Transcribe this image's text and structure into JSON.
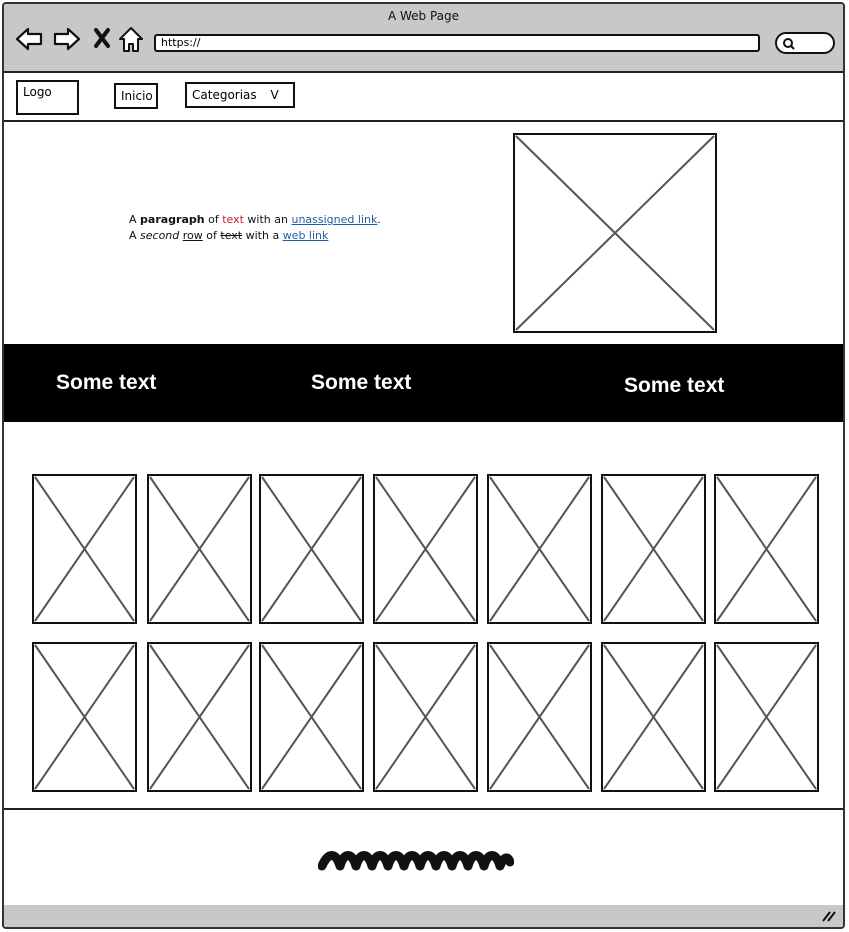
{
  "window": {
    "title": "A Web Page"
  },
  "browser": {
    "url": "https://",
    "icons": [
      "back-arrow-icon",
      "forward-arrow-icon",
      "close-x-icon",
      "home-icon",
      "search-icon",
      "resize-grip-icon"
    ]
  },
  "nav": {
    "logo": "Logo",
    "home": "Inicio",
    "categories": "Categorias",
    "categories_caret": "V"
  },
  "hero": {
    "line1": {
      "p1": "A ",
      "bold": "paragraph",
      "p2": " of ",
      "red": "text",
      "p3": " with an ",
      "link": "unassigned link",
      "p4": "."
    },
    "line2": {
      "p1": "A ",
      "italic": "second",
      "p2": " ",
      "underline": "row",
      "p3": " of ",
      "strike": "text",
      "p4": " with a ",
      "link": "web link"
    }
  },
  "band": {
    "items": [
      "Some text",
      "Some text",
      "Some text"
    ]
  },
  "colors": {
    "chrome": "#c8c8c8",
    "link": "#1f5fa8",
    "red_text": "#c8201f",
    "band": "#000000"
  }
}
